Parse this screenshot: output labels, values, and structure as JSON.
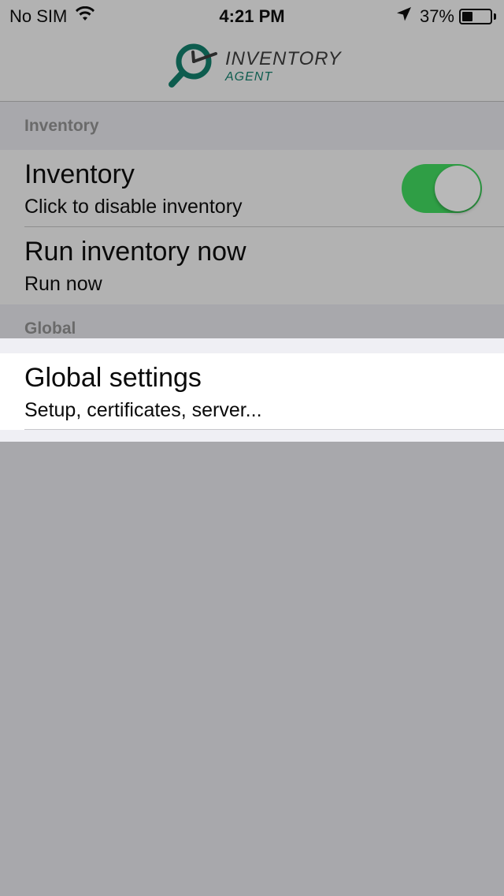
{
  "status_bar": {
    "carrier": "No SIM",
    "time": "4:21 PM",
    "battery_percent": "37%",
    "battery_level": 0.37,
    "icons": [
      "wifi-icon",
      "location-arrow-icon",
      "battery-icon"
    ]
  },
  "nav": {
    "logo_title": "INVENTORY",
    "logo_subtitle": "AGENT",
    "logo_colors": {
      "primary": "#0d5c4e",
      "text": "#2c2c2c"
    }
  },
  "sections": {
    "inventory_header": "Inventory",
    "global_header": "Global"
  },
  "cells": {
    "inventory": {
      "title": "Inventory",
      "subtitle": "Click to disable inventory",
      "toggle_on": true,
      "toggle_color": "#2f9e45"
    },
    "run_inventory": {
      "title": "Run inventory now",
      "subtitle": "Run now"
    },
    "global_settings": {
      "title": "Global settings",
      "subtitle": "Setup, certificates, server..."
    }
  }
}
